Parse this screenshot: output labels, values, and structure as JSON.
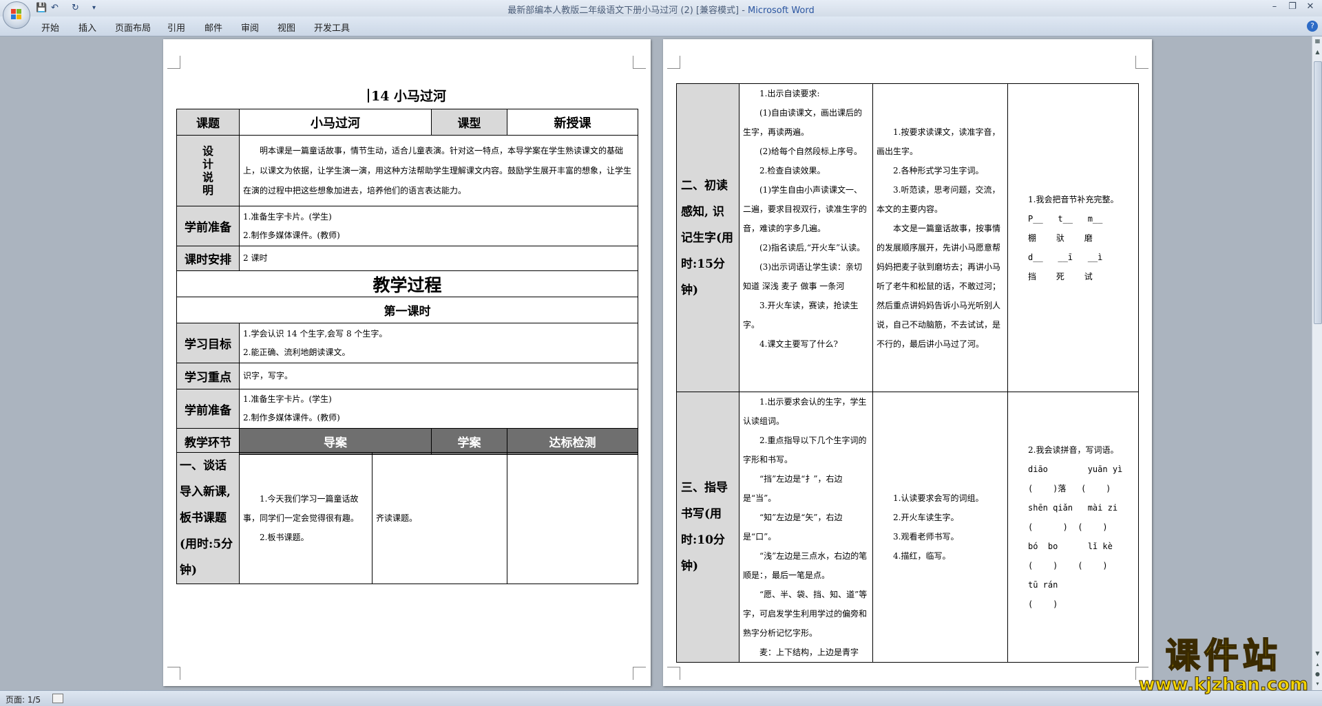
{
  "window": {
    "title": "最新部编本人教版二年级语文下册小马过河 (2) [兼容模式]",
    "app_name": "Microsoft Word",
    "separator": " - "
  },
  "menu": [
    "开始",
    "插入",
    "页面布局",
    "引用",
    "邮件",
    "审阅",
    "视图",
    "开发工具"
  ],
  "status": {
    "page_info": "页面: 1/5"
  },
  "watermark": {
    "brand": "课件站",
    "url": "www.kjzhan.com"
  },
  "page1": {
    "title": "14  小马过河",
    "rows": {
      "topic_label": "课题",
      "topic_value": "小马过河",
      "type_label": "课型",
      "type_value": "新授课",
      "design_label": "设计说明",
      "design_text": "明本课是一篇童话故事，情节生动，适合儿童表演。针对这一特点，本导学案在学生熟读课文的基础上，以课文为依据，让学生演一演，用这种方法帮助学生理解课文内容。鼓励学生展开丰富的想象，让学生在演的过程中把这些想象加进去，培养他们的语言表达能力。",
      "prep_label": "学前准备",
      "prep_lines": [
        "1.准备生字卡片。(学生)",
        "2.制作多媒体课件。(教师)"
      ],
      "time_label": "课时安排",
      "time_value": "2 课时",
      "process_title": "教学过程",
      "lesson_title": "第一课时",
      "goal_label": "学习目标",
      "goal_lines": [
        "1.学会认识 14 个生字,会写 8 个生字。",
        "2.能正确、流利地朗读课文。"
      ],
      "focus_label": "学习重点",
      "focus_value": "识字，写字。",
      "prep2_label": "学前准备",
      "prep2_lines": [
        "1.准备生字卡片。(学生)",
        "2.制作多媒体课件。(教师)"
      ],
      "stage_label": "教学环节",
      "col_guide": "导案",
      "col_study": "学案",
      "col_check": "达标检测",
      "stage1_label": "一、谈话导入新课, 板书课题(用时:5分钟)",
      "stage1_guide": [
        "1.今天我们学习一篇童话故事，同学们一定会觉得很有趣。",
        "2.板书课题。"
      ],
      "stage1_study": "齐读课题。"
    }
  },
  "page2": {
    "stage2_label": "二、初读感知, 识记生字(用时:15分钟)",
    "stage2_guide": [
      "1.出示自读要求:",
      "(1)自由读课文，画出课后的生字，再读两遍。",
      "(2)给每个自然段标上序号。",
      "2.检查自读效果。",
      "(1)学生自由小声读课文一、二遍，要求目视双行，读准生字的音，难读的字多几遍。",
      "(2)指名读后,“开火车”认读。",
      "(3)出示词语让学生读：亲切  知道  深浅  麦子  做事  一条河",
      "3.开火车读，赛读，抢读生字。",
      "4.课文主要写了什么?"
    ],
    "stage2_study": [
      "1.按要求读课文，读准字音，画出生字。",
      "2.各种形式学习生字词。",
      "3.听范读，思考问题，交流，本文的主要内容。",
      "本文是一篇童话故事，按事情的发展顺序展开，先讲小马愿意帮妈妈把麦子驮到磨坊去；再讲小马听了老牛和松鼠的话，不敢过河；然后重点讲妈妈告诉小马光听别人说，自己不动脑筋，不去试试，是不行的，最后讲小马过了河。"
    ],
    "stage2_check": [
      "1.我会把音节补充完整。",
      "P__   t__   m__",
      "棚    驮    磨",
      "d__   __ī   __ì",
      "挡    死    试"
    ],
    "stage3_label": "三、指导书写(用时:10分钟)",
    "stage3_guide": [
      "1.出示要求会认的生字，学生认读组词。",
      "2.重点指导以下几个生字词的字形和书写。",
      "“挡”左边是“扌”，右边是“当”。",
      "“知”左边是“矢”，右边是“口”。",
      "“浅”左边是三点水，右边的笔顺是：，最后一笔是点。",
      "“愿、半、袋、挡、知、道”等字，可启发学生利用学过的偏旁和熟字分析记忆字形。",
      "麦：上下结构，上边是青字"
    ],
    "stage3_study": [
      "1.认读要求会写的词组。",
      "2.开火车读生字。",
      "3.观看老师书写。",
      "4.描红，临写。"
    ],
    "stage3_check": [
      "2.我会读拼音，写词语。",
      "diāo        yuān yì",
      "(    )落   (    )",
      "shēn qiǎn   mài zi",
      "(      )  (    )",
      "bó  bo      lǐ kè",
      "(    )    (    )",
      "tū rán",
      "(    )"
    ]
  }
}
